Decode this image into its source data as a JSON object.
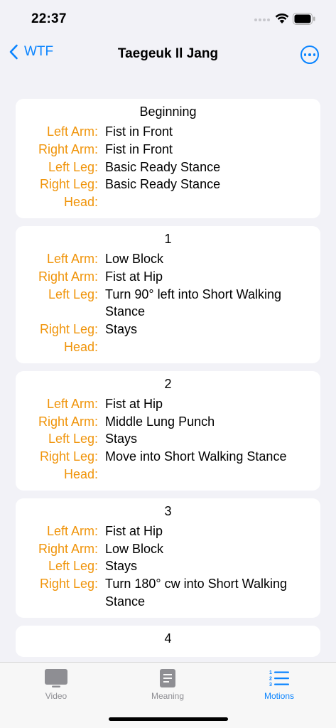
{
  "status_bar": {
    "time": "22:37"
  },
  "nav": {
    "back_label": "WTF",
    "title": "Taegeuk Il Jang"
  },
  "cards": [
    {
      "title": "Beginning",
      "rows": [
        {
          "label": "Left Arm:",
          "value": "Fist in Front"
        },
        {
          "label": "Right Arm:",
          "value": "Fist in Front"
        },
        {
          "label": "Left Leg:",
          "value": "Basic Ready Stance"
        },
        {
          "label": "Right Leg:",
          "value": "Basic Ready Stance"
        },
        {
          "label": "Head:",
          "value": ""
        }
      ]
    },
    {
      "title": "1",
      "rows": [
        {
          "label": "Left Arm:",
          "value": "Low Block"
        },
        {
          "label": "Right Arm:",
          "value": "Fist at Hip"
        },
        {
          "label": "Left Leg:",
          "value": "Turn 90° left into Short Walking Stance"
        },
        {
          "label": "Right Leg:",
          "value": "Stays"
        },
        {
          "label": "Head:",
          "value": ""
        }
      ]
    },
    {
      "title": "2",
      "rows": [
        {
          "label": "Left Arm:",
          "value": "Fist at Hip"
        },
        {
          "label": "Right Arm:",
          "value": "Middle Lung Punch"
        },
        {
          "label": "Left Leg:",
          "value": "Stays"
        },
        {
          "label": "Right Leg:",
          "value": "Move into Short Walking Stance"
        },
        {
          "label": "Head:",
          "value": ""
        }
      ]
    },
    {
      "title": "3",
      "rows": [
        {
          "label": "Left Arm:",
          "value": "Fist at Hip"
        },
        {
          "label": "Right Arm:",
          "value": "Low Block"
        },
        {
          "label": "Left Leg:",
          "value": "Stays"
        },
        {
          "label": "Right Leg:",
          "value": "Turn 180° cw into Short Walking Stance"
        }
      ]
    },
    {
      "title": "4",
      "rows": []
    }
  ],
  "tabs": [
    {
      "label": "Video",
      "icon": "tv-icon",
      "active": false
    },
    {
      "label": "Meaning",
      "icon": "document-icon",
      "active": false
    },
    {
      "label": "Motions",
      "icon": "numbered-list-icon",
      "active": true
    }
  ],
  "colors": {
    "accent": "#0a84ff",
    "label": "#f0940a",
    "background": "#f2f2f7",
    "inactive_tab": "#8e8e93"
  }
}
